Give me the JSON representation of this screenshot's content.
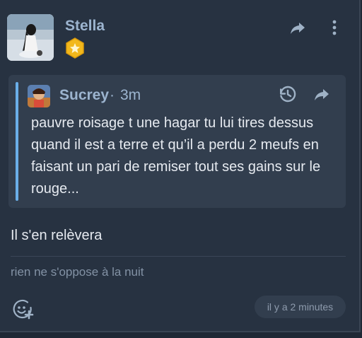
{
  "post": {
    "author": "Stella",
    "badge_icon": "star-badge-icon",
    "share_icon": "share-icon",
    "menu_icon": "more-vertical-icon"
  },
  "quote": {
    "author": "Sucrey",
    "separator": "·",
    "time": "3m",
    "text": "pauvre roisage t une hagar tu lui tires dessus quand il est a terre et qu’il a perdu 2 meufs en faisant un pari de remiser tout ses gains sur le rouge...",
    "history_icon": "history-icon",
    "share_icon": "share-icon"
  },
  "body": {
    "message": "Il s'en relèvera",
    "signature": "rien ne s'oppose à la nuit"
  },
  "footer": {
    "react_icon": "add-reaction-icon",
    "timestamp": "il y a 2 minutes"
  },
  "colors": {
    "background": "#1f2835",
    "card": "#273241",
    "quote_bg": "#323e4e",
    "quote_bar": "#6aaee8",
    "author": "#9cb4cf",
    "badge": "#f2b81c"
  }
}
